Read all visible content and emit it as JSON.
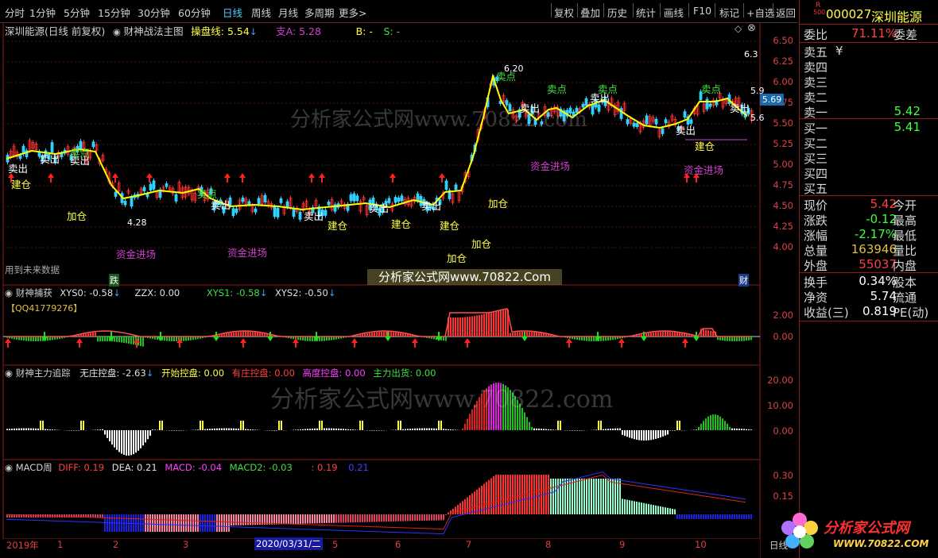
{
  "toolbar": {
    "periods": [
      "分时",
      "1分钟",
      "5分钟",
      "15分钟",
      "30分钟",
      "60分钟",
      "日线",
      "周线",
      "月线",
      "多周期",
      "更多>"
    ],
    "active_period": "日线",
    "tools": [
      "复权",
      "叠加",
      "历史",
      "统计",
      "画线",
      "F10",
      "标记",
      "+自选",
      "返回"
    ]
  },
  "chart": {
    "title": "深圳能源(日线 前复权)",
    "indicator_main": "财神战法主图",
    "caopan_label": "操盘线: 5.54",
    "zhi_label": "支A: 5.28",
    "b_label": "B: -",
    "s_label": "S: -",
    "future_note": "用到未来数据",
    "die_badge": "跌",
    "cai_badge": "财",
    "price_axis": [
      "6.50",
      "6.25",
      "6.00",
      "5.75",
      "5.50",
      "5.25",
      "5.00",
      "4.75",
      "4.50",
      "4.25",
      "4.00"
    ],
    "current_price_tag": "5.69",
    "hi_label": "6.20",
    "lo_label": "4.28",
    "right_labels": [
      "6.3",
      "5.9",
      "5.6"
    ],
    "watermark_1": "分析家公式网www.70822.com",
    "watermark_2": "分析家公式网www.70822.Com",
    "watermark_3": "分析家公式网www.70822.com",
    "signals": {
      "sell": "卖出",
      "sellpoint": "卖点",
      "build": "建仓",
      "add": "加仓",
      "fund": "资金进场"
    }
  },
  "panel2": {
    "name": "财神捕获",
    "xys0": "XYS0: -0.58",
    "zzx": "ZZX: 0.00",
    "xys1": "XYS1: -0.58",
    "xys2": "XYS2: -0.50",
    "qq": "【QQ41779276】",
    "axis": [
      "2.00",
      "0.00"
    ]
  },
  "panel3": {
    "name": "财神主力追踪",
    "wuzhuang": "无庄控盘: -2.63",
    "kaishi": "开始控盘: 0.00",
    "youzhuang": "有庄控盘: 0.00",
    "gaodu": "高度控盘: 0.00",
    "chuhuo": "主力出货: 0.00",
    "axis": [
      "20.00",
      "10.00",
      "0.00"
    ]
  },
  "panel4": {
    "name": "MACD周",
    "diff": "DIFF: 0.19",
    "dea": "DEA: 0.21",
    "macd": "MACD: -0.04",
    "macd2": "MACD2: -0.03",
    "v1": ": 0.19",
    "v2": "0.21",
    "axis": [
      "0.30",
      "0.15"
    ]
  },
  "timeline": {
    "labels": [
      "2019年",
      "1",
      "2",
      "3",
      "2020/03/31/二",
      "5",
      "6",
      "7",
      "8",
      "9",
      "10"
    ],
    "rbtn": "日线"
  },
  "quote": {
    "code": "000027",
    "name": "深圳能源",
    "r_badge": "R",
    "r_num": "500",
    "weibi_lbl": "委比",
    "weibi_val": "71.11%",
    "weicha_lbl": "委差",
    "sell_rows": [
      {
        "label": "卖五",
        "price": "",
        "extra": "¥"
      },
      {
        "label": "卖四",
        "price": ""
      },
      {
        "label": "卖三",
        "price": ""
      },
      {
        "label": "卖二",
        "price": ""
      },
      {
        "label": "卖一",
        "price": "5.42"
      }
    ],
    "buy_rows": [
      {
        "label": "买一",
        "price": "5.41"
      },
      {
        "label": "买二",
        "price": ""
      },
      {
        "label": "买三",
        "price": ""
      },
      {
        "label": "买四",
        "price": ""
      },
      {
        "label": "买五",
        "price": ""
      }
    ],
    "stats": [
      {
        "l": "现价",
        "v": "5.42",
        "r": "今开",
        "c": "#ff4040"
      },
      {
        "l": "涨跌",
        "v": "-0.12",
        "r": "最高",
        "c": "#40ff40"
      },
      {
        "l": "涨幅",
        "v": "-2.17%",
        "r": "最低",
        "c": "#40ff40"
      },
      {
        "l": "总量",
        "v": "163946",
        "r": "量比",
        "c": "#e0c040"
      },
      {
        "l": "外盘",
        "v": "55037",
        "r": "内盘",
        "c": "#ff4040"
      }
    ],
    "finance": [
      {
        "l": "换手",
        "v": "0.34%",
        "r": "股本"
      },
      {
        "l": "净资",
        "v": "5.74",
        "r": "流通"
      },
      {
        "l": "收益(三)",
        "v": "0.819",
        "r": "PE(动)"
      }
    ],
    "logo_text": "分析家公式网",
    "logo_url": "WWW.70822.COM"
  }
}
